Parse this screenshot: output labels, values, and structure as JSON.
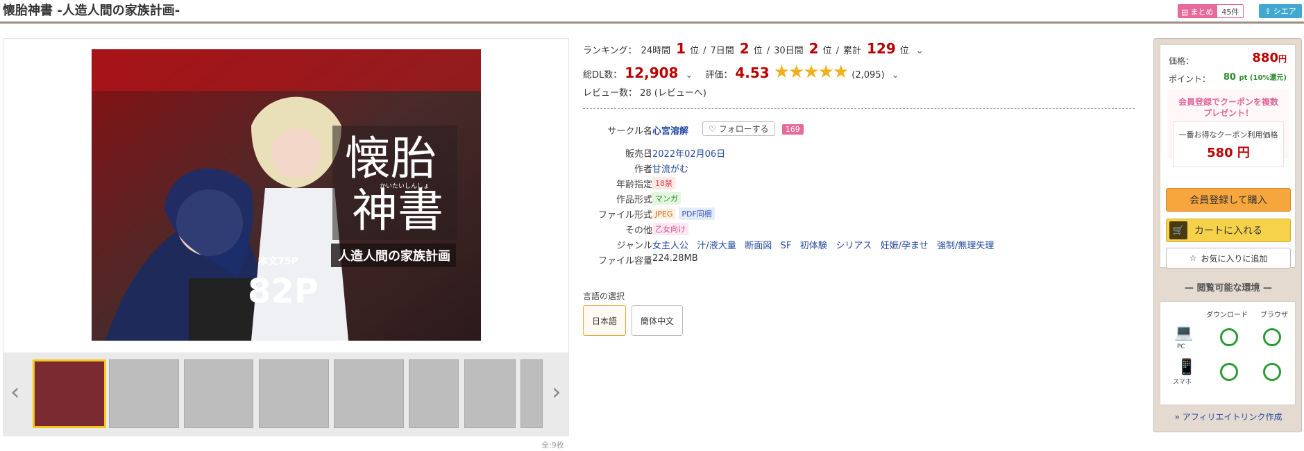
{
  "title": "懐胎神書 -人造人間の家族計画-",
  "header": {
    "matome_label": "まとめ",
    "matome_count": "45件",
    "share_label": "シエア"
  },
  "cover_texts": {
    "title_line1": "懐胎",
    "title_line2": "神書",
    "reading": "かいたいしんしょ",
    "subtitle": "人造人間の家族計画",
    "body_pages": "本文75P",
    "total_pages": "82P"
  },
  "gallery": {
    "count_note": "全:9枚",
    "thumbnails": [
      "thumb-1",
      "thumb-2",
      "thumb-3",
      "thumb-4",
      "thumb-5",
      "thumb-6",
      "thumb-7",
      "thumb-8"
    ]
  },
  "ranking": {
    "label": "ランキング：",
    "h24_label": "24時間",
    "h24_value": "1",
    "d7_label": "7日間",
    "d7_value": "2",
    "d30_label": "30日間",
    "d30_value": "2",
    "total_label": "累計",
    "total_value": "129",
    "unit": "位",
    "sep": "/"
  },
  "sales": {
    "dl_label": "総DL数：",
    "dl_value": "12,908",
    "rating_label": "評価：",
    "rating_value": "4.53",
    "stars_filled": 5,
    "rating_count": "(2,095)",
    "review_text": "レビュー数： 28 (レビューへ)"
  },
  "specs": [
    {
      "key": "サークル名",
      "value": "心宮溶解"
    },
    {
      "key": "販売日",
      "value": "2022年02月06日"
    },
    {
      "key": "作者",
      "value": "甘流がむ"
    },
    {
      "key": "年齢指定",
      "value": "18禁"
    },
    {
      "key": "作品形式",
      "value": "マンガ"
    },
    {
      "key": "ファイル形式",
      "value": "JPEG",
      "value2": "PDF同梱"
    },
    {
      "key": "その他",
      "value": "乙女向け"
    },
    {
      "key": "ジャンル",
      "genres": [
        "女主人公",
        "汁/液大量",
        "断面図",
        "SF",
        "初体験",
        "シリアス",
        "妊娠/孕ませ",
        "強制/無理矢理"
      ]
    },
    {
      "key": "ファイル容量",
      "value": "224.28MB"
    }
  ],
  "follow": {
    "label": "フォローする",
    "count": "169"
  },
  "language": {
    "label": "言語の選択",
    "options": [
      "日本語",
      "簡体中文"
    ]
  },
  "price": {
    "price_label": "価格：",
    "price_value": "880",
    "price_unit": "円",
    "point_label": "ポイント：",
    "point_value": "80",
    "point_suffix": "pt (10%還元)",
    "coupon_line1": "会員登録でクーポンを複数",
    "coupon_line2": "プレゼント！",
    "coupon_caption": "一番お得なクーポン利用価格",
    "coupon_price": "580 円"
  },
  "buttons": {
    "buy": "会員登録して購入",
    "cart": "カートに入れる",
    "fav": "お気に入りに追加"
  },
  "environment": {
    "title": "閲覧可能な環境",
    "col_download": "ダウンロード",
    "col_browser": "ブラウザ",
    "row_pc": "PC",
    "row_phone": "スマホ"
  },
  "affiliate": "» アフィリエイトリンク作成",
  "colors": {
    "accent_red": "#bb0000",
    "pink": "#e8699b",
    "green": "#2d9a36",
    "orange": "#f7a63d",
    "yellow": "#f6d24a"
  }
}
